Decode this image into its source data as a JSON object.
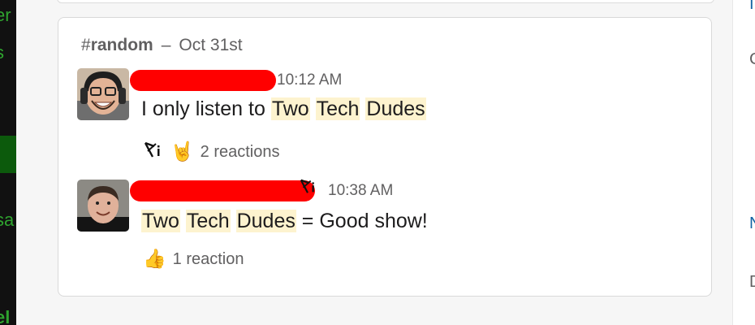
{
  "sidebar": {
    "fragments": [
      "er",
      "s",
      "sa",
      "el"
    ]
  },
  "right_panel": {
    "fragments": [
      "I",
      "C",
      "N",
      "D"
    ]
  },
  "search_result": {
    "channel_hash": "#",
    "channel_name": "random",
    "separator": "–",
    "date": "Oct 31st"
  },
  "messages": [
    {
      "time": "10:12 AM",
      "text_parts": [
        "I only listen to ",
        "Two",
        "Tech",
        "Dudes"
      ],
      "reactions": {
        "emojis": [
          "custom-emoji-icon",
          "sign-of-horns-emoji"
        ],
        "label": "2 reactions"
      }
    },
    {
      "time": "10:38 AM",
      "text_parts": [
        "Two",
        "Tech",
        "Dudes",
        "= Good show!"
      ],
      "reactions": {
        "emojis": [
          "thumbs-up-emoji"
        ],
        "label": "1 reaction"
      }
    }
  ],
  "colors": {
    "highlight": "#fdf3cf",
    "redaction": "#ff0000",
    "link": "#1264a3",
    "sidebar_green": "#2fa42f"
  }
}
